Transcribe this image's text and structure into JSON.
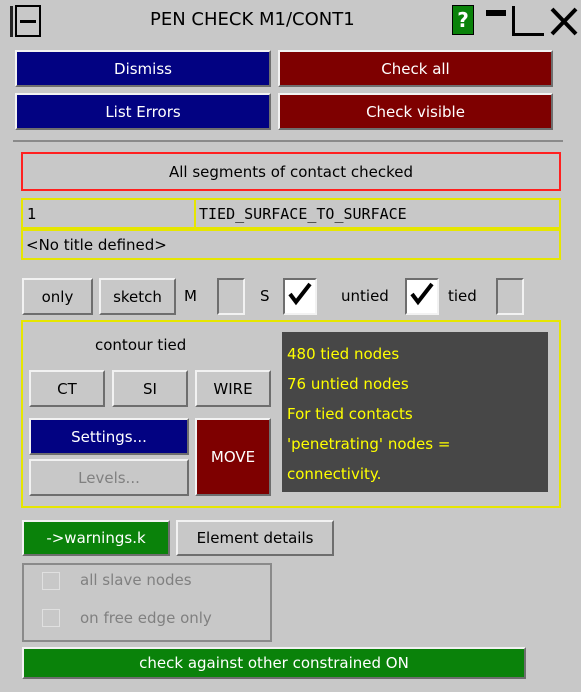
{
  "title_bar": {
    "title": "PEN CHECK M1/CONT1",
    "help_label": "?"
  },
  "buttons": {
    "dismiss": "Dismiss",
    "check_all": "Check all",
    "list_errors": "List Errors",
    "check_visible": "Check visible"
  },
  "status": {
    "message": "All segments of contact checked"
  },
  "contact": {
    "id": "1",
    "type": "TIED_SURFACE_TO_SURFACE",
    "title": "<No title defined>"
  },
  "options": {
    "only_label": "only",
    "sketch_label": "sketch",
    "m_label": "M",
    "s_label": "S",
    "untied_label": "untied",
    "tied_label": "tied",
    "m_checked": false,
    "s_checked": true,
    "untied_checked": true,
    "tied_checked": false
  },
  "contour": {
    "title": "contour tied",
    "ct_label": "CT",
    "si_label": "SI",
    "wire_label": "WIRE",
    "settings_label": "Settings...",
    "levels_label": "Levels...",
    "move_label": "MOVE"
  },
  "info_lines": [
    "480 tied nodes",
    "76 untied nodes",
    "For tied contacts",
    "'penetrating' nodes =",
    "connectivity."
  ],
  "bottom": {
    "warnings_label": "->warnings.k",
    "element_details_label": "Element details",
    "all_slave_nodes_label": "all slave nodes",
    "free_edge_label": "on free edge only",
    "constrained_label": "check against other constrained ON"
  },
  "colors": {
    "panel_bg": "#c8c8c8",
    "blue_button": "#020282",
    "red_button": "#7e0000",
    "green_button": "#0a820a",
    "info_bg": "#474747",
    "info_text": "#ffff00",
    "highlight_border": "#e6e600",
    "status_border": "#ff2020"
  }
}
